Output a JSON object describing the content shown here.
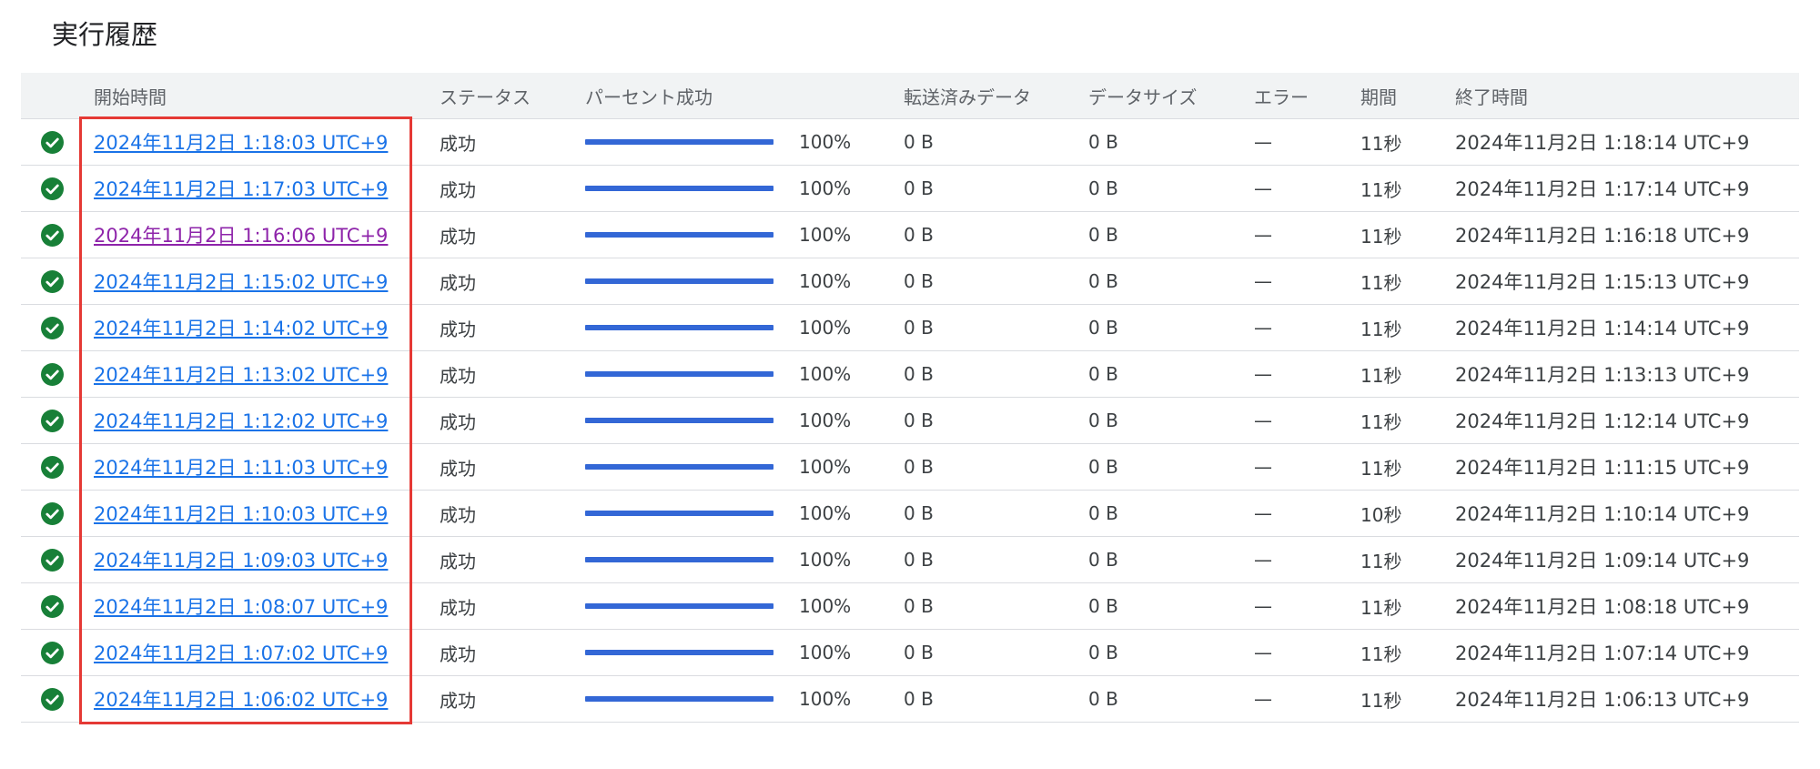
{
  "page": {
    "title": "実行履歴"
  },
  "colors": {
    "success_icon": "#188038",
    "link": "#1a73e8",
    "visited_link": "#8e24aa",
    "progress_bar": "#3367d6",
    "highlight_border": "#e53935"
  },
  "table": {
    "headers": {
      "start_time": "開始時間",
      "status": "ステータス",
      "percent_success": "パーセント成功",
      "transferred": "転送済みデータ",
      "data_size": "データサイズ",
      "errors": "エラー",
      "duration": "期間",
      "end_time": "終了時間"
    },
    "rows": [
      {
        "icon": "check-circle-icon",
        "start": "2024年11月2日 1:18:03 UTC+9",
        "visited": false,
        "status": "成功",
        "progress": 100,
        "percent": "100%",
        "transferred": "0 B",
        "size": "0 B",
        "errors": "—",
        "duration": "11秒",
        "end": "2024年11月2日 1:18:14 UTC+9"
      },
      {
        "icon": "check-circle-icon",
        "start": "2024年11月2日 1:17:03 UTC+9",
        "visited": false,
        "status": "成功",
        "progress": 100,
        "percent": "100%",
        "transferred": "0 B",
        "size": "0 B",
        "errors": "—",
        "duration": "11秒",
        "end": "2024年11月2日 1:17:14 UTC+9"
      },
      {
        "icon": "check-circle-icon",
        "start": "2024年11月2日 1:16:06 UTC+9",
        "visited": true,
        "status": "成功",
        "progress": 100,
        "percent": "100%",
        "transferred": "0 B",
        "size": "0 B",
        "errors": "—",
        "duration": "11秒",
        "end": "2024年11月2日 1:16:18 UTC+9"
      },
      {
        "icon": "check-circle-icon",
        "start": "2024年11月2日 1:15:02 UTC+9",
        "visited": false,
        "status": "成功",
        "progress": 100,
        "percent": "100%",
        "transferred": "0 B",
        "size": "0 B",
        "errors": "—",
        "duration": "11秒",
        "end": "2024年11月2日 1:15:13 UTC+9"
      },
      {
        "icon": "check-circle-icon",
        "start": "2024年11月2日 1:14:02 UTC+9",
        "visited": false,
        "status": "成功",
        "progress": 100,
        "percent": "100%",
        "transferred": "0 B",
        "size": "0 B",
        "errors": "—",
        "duration": "11秒",
        "end": "2024年11月2日 1:14:14 UTC+9"
      },
      {
        "icon": "check-circle-icon",
        "start": "2024年11月2日 1:13:02 UTC+9",
        "visited": false,
        "status": "成功",
        "progress": 100,
        "percent": "100%",
        "transferred": "0 B",
        "size": "0 B",
        "errors": "—",
        "duration": "11秒",
        "end": "2024年11月2日 1:13:13 UTC+9"
      },
      {
        "icon": "check-circle-icon",
        "start": "2024年11月2日 1:12:02 UTC+9",
        "visited": false,
        "status": "成功",
        "progress": 100,
        "percent": "100%",
        "transferred": "0 B",
        "size": "0 B",
        "errors": "—",
        "duration": "11秒",
        "end": "2024年11月2日 1:12:14 UTC+9"
      },
      {
        "icon": "check-circle-icon",
        "start": "2024年11月2日 1:11:03 UTC+9",
        "visited": false,
        "status": "成功",
        "progress": 100,
        "percent": "100%",
        "transferred": "0 B",
        "size": "0 B",
        "errors": "—",
        "duration": "11秒",
        "end": "2024年11月2日 1:11:15 UTC+9"
      },
      {
        "icon": "check-circle-icon",
        "start": "2024年11月2日 1:10:03 UTC+9",
        "visited": false,
        "status": "成功",
        "progress": 100,
        "percent": "100%",
        "transferred": "0 B",
        "size": "0 B",
        "errors": "—",
        "duration": "10秒",
        "end": "2024年11月2日 1:10:14 UTC+9"
      },
      {
        "icon": "check-circle-icon",
        "start": "2024年11月2日 1:09:03 UTC+9",
        "visited": false,
        "status": "成功",
        "progress": 100,
        "percent": "100%",
        "transferred": "0 B",
        "size": "0 B",
        "errors": "—",
        "duration": "11秒",
        "end": "2024年11月2日 1:09:14 UTC+9"
      },
      {
        "icon": "check-circle-icon",
        "start": "2024年11月2日 1:08:07 UTC+9",
        "visited": false,
        "status": "成功",
        "progress": 100,
        "percent": "100%",
        "transferred": "0 B",
        "size": "0 B",
        "errors": "—",
        "duration": "11秒",
        "end": "2024年11月2日 1:08:18 UTC+9"
      },
      {
        "icon": "check-circle-icon",
        "start": "2024年11月2日 1:07:02 UTC+9",
        "visited": false,
        "status": "成功",
        "progress": 100,
        "percent": "100%",
        "transferred": "0 B",
        "size": "0 B",
        "errors": "—",
        "duration": "11秒",
        "end": "2024年11月2日 1:07:14 UTC+9"
      },
      {
        "icon": "check-circle-icon",
        "start": "2024年11月2日 1:06:02 UTC+9",
        "visited": false,
        "status": "成功",
        "progress": 100,
        "percent": "100%",
        "transferred": "0 B",
        "size": "0 B",
        "errors": "—",
        "duration": "11秒",
        "end": "2024年11月2日 1:06:13 UTC+9"
      }
    ]
  }
}
